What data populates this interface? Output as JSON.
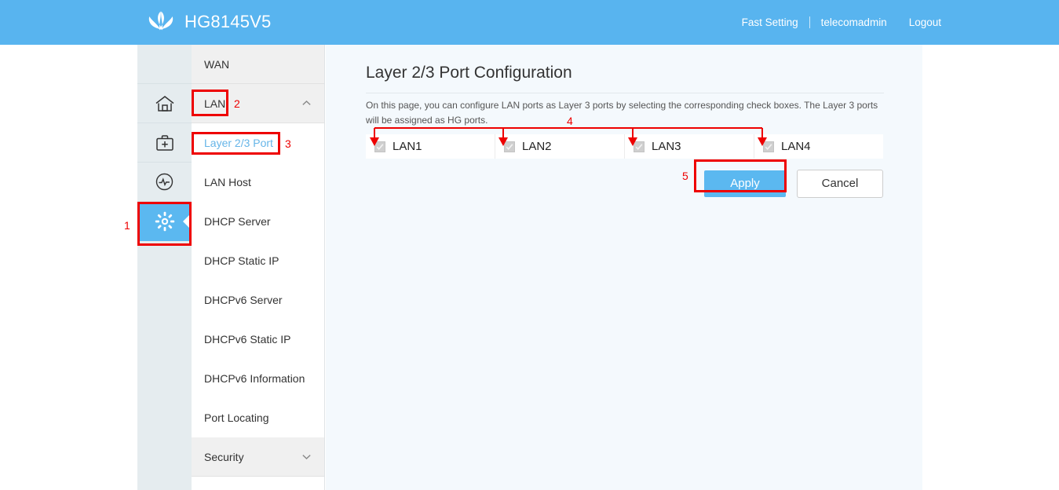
{
  "header": {
    "logo_icon": "huawei-logo-icon",
    "product": "HG8145V5",
    "fast_setting": "Fast Setting",
    "username": "telecomadmin",
    "logout": "Logout",
    "bg_color": "#58b4ef"
  },
  "rail": {
    "items": [
      {
        "icon": "home-icon",
        "name": "home",
        "active": false
      },
      {
        "icon": "toolkit-icon",
        "name": "maintenance",
        "active": false
      },
      {
        "icon": "status-monitor-icon",
        "name": "status",
        "active": false
      },
      {
        "icon": "gear-icon",
        "name": "advanced-settings",
        "active": true
      }
    ],
    "active_color": "#5bb8f0"
  },
  "menu": {
    "items": [
      {
        "label": "WAN",
        "type": "group",
        "expanded": false,
        "active": false
      },
      {
        "label": "LAN",
        "type": "group",
        "expanded": true,
        "active": false
      },
      {
        "label": "Layer 2/3 Port",
        "type": "item",
        "active": true
      },
      {
        "label": "LAN Host",
        "type": "item",
        "active": false
      },
      {
        "label": "DHCP Server",
        "type": "item",
        "active": false
      },
      {
        "label": "DHCP Static IP",
        "type": "item",
        "active": false
      },
      {
        "label": "DHCPv6 Server",
        "type": "item",
        "active": false
      },
      {
        "label": "DHCPv6 Static IP",
        "type": "item",
        "active": false
      },
      {
        "label": "DHCPv6 Information",
        "type": "item",
        "active": false
      },
      {
        "label": "Port Locating",
        "type": "item",
        "active": false
      },
      {
        "label": "Security",
        "type": "group",
        "expanded": false,
        "active": false
      }
    ],
    "active_color": "#66b5e8"
  },
  "main": {
    "title": "Layer 2/3 Port Configuration",
    "description": "On this page, you can configure LAN ports as Layer 3 ports by selecting the corresponding check boxes. The Layer 3 ports will be assigned as HG ports.",
    "ports": [
      {
        "label": "LAN1",
        "checked": true,
        "disabled": true
      },
      {
        "label": "LAN2",
        "checked": true,
        "disabled": true
      },
      {
        "label": "LAN3",
        "checked": true,
        "disabled": true
      },
      {
        "label": "LAN4",
        "checked": true,
        "disabled": true
      }
    ],
    "apply_label": "Apply",
    "cancel_label": "Cancel"
  },
  "annotations": {
    "color": "#ee0000",
    "steps": [
      {
        "number": "1",
        "target": "advanced-settings-rail-icon"
      },
      {
        "number": "2",
        "target": "menu-group-lan"
      },
      {
        "number": "3",
        "target": "menu-item-layer-2-3-port"
      },
      {
        "number": "4",
        "target": "lan-port-checkboxes"
      },
      {
        "number": "5",
        "target": "apply-button"
      }
    ]
  }
}
